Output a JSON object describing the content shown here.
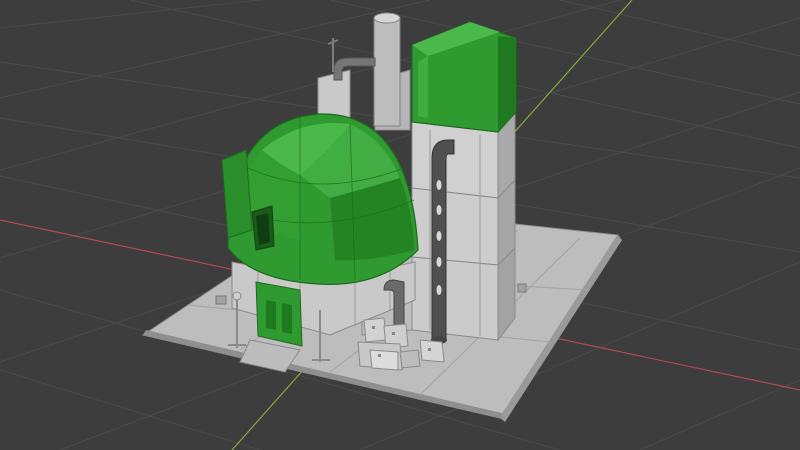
{
  "app": {
    "name": "3D Viewport"
  },
  "colors": {
    "background": "#3d3d3d",
    "grid": "#4b4b4b",
    "x_axis": "#b04a55",
    "y_axis": "#8aa838",
    "dome_green": "#2f9a2f",
    "light_green": "#4ab84a",
    "dark_green": "#1f6a1f",
    "metal_light": "#d0d0d0",
    "metal_mid": "#a9a9a9",
    "metal_dark": "#7c7c7c",
    "pipe_dark": "#505050"
  },
  "scene": {
    "objects": [
      "ground-platform",
      "green-dome",
      "dome-door",
      "tower-stack",
      "green-roof-block",
      "chimney-pipe",
      "vertical-exhaust-pipe",
      "supply-crates",
      "antenna",
      "lamp-posts"
    ]
  }
}
